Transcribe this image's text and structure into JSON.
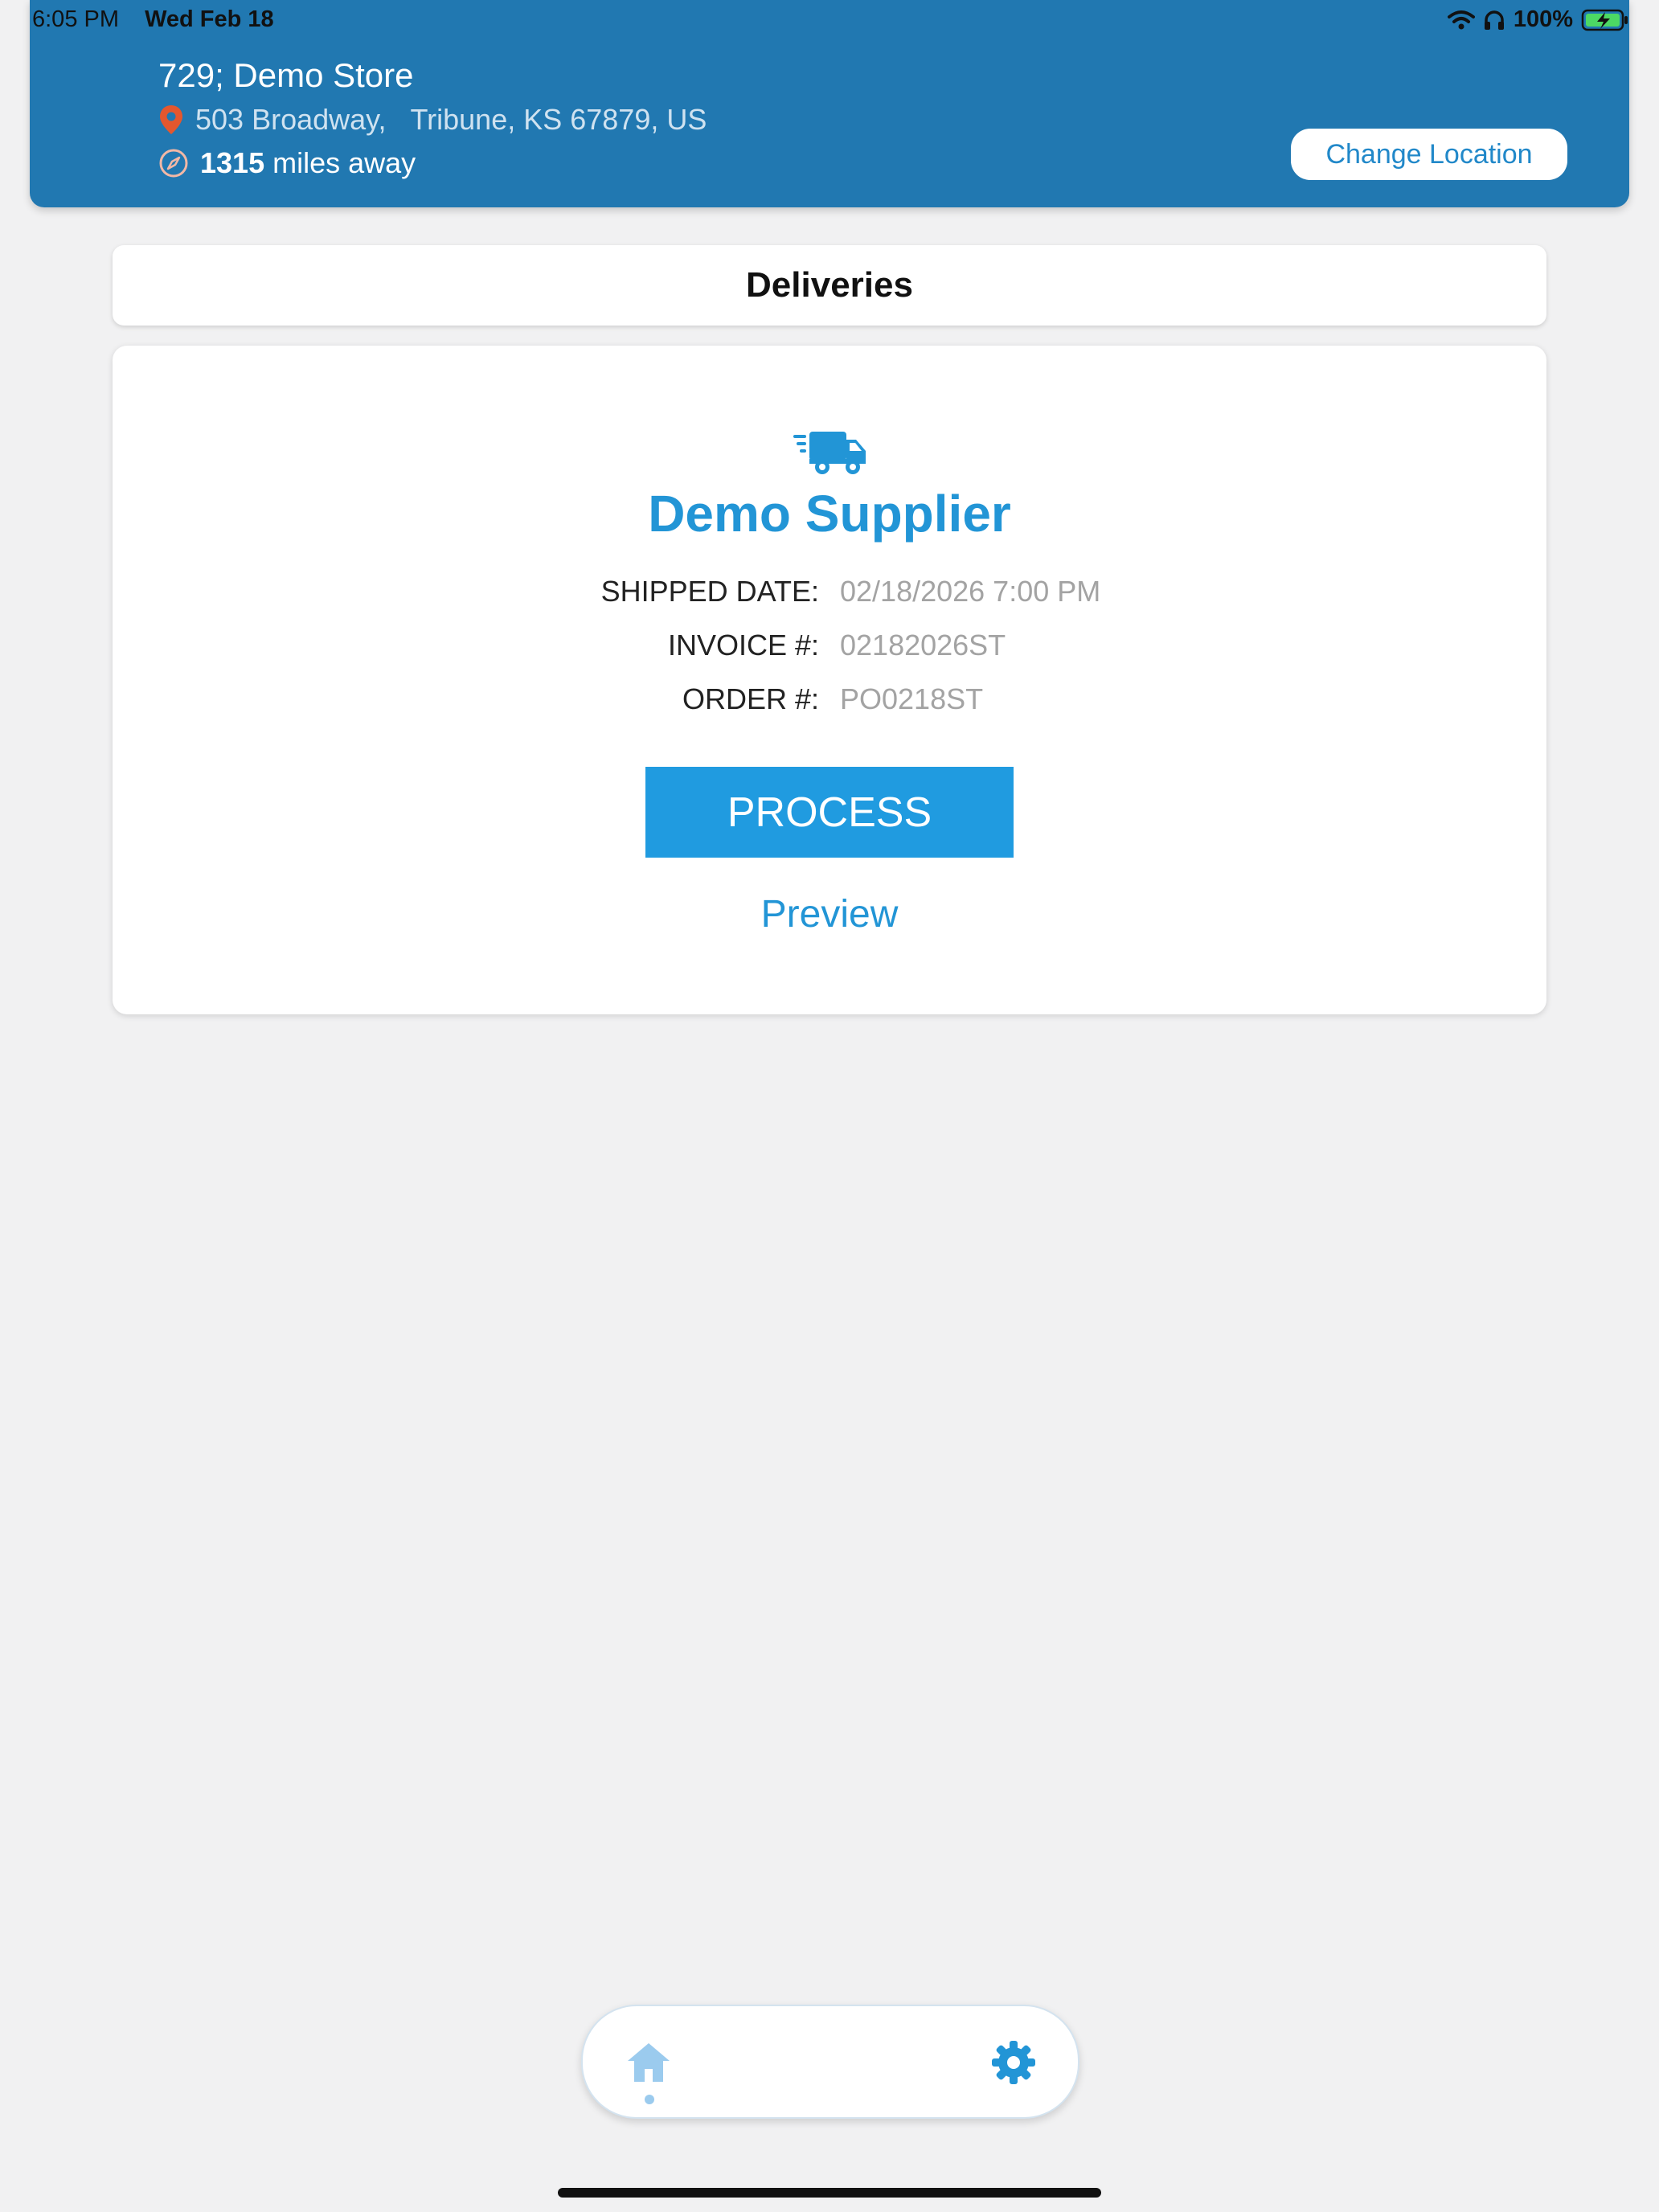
{
  "status_bar": {
    "time": "6:05 PM",
    "date": "Wed Feb 18",
    "battery": "100%"
  },
  "store": {
    "name": "729; Demo Store",
    "address_line": "503 Broadway,",
    "address_city": "Tribune, KS 67879, US",
    "distance_value": "1315",
    "distance_unit": "miles away",
    "change_location_label": "Change Location"
  },
  "page": {
    "title": "Deliveries"
  },
  "delivery": {
    "supplier": "Demo Supplier",
    "fields": [
      {
        "label": "SHIPPED DATE:",
        "value": "02/18/2026 7:00 PM"
      },
      {
        "label": "INVOICE #:",
        "value": "02182026ST"
      },
      {
        "label": "ORDER #:",
        "value": "PO0218ST"
      }
    ],
    "process_label": "PROCESS",
    "preview_label": "Preview"
  },
  "tabbar": {
    "items": [
      {
        "icon": "home-icon",
        "active": true
      },
      {
        "icon": "gear-icon",
        "active": false
      }
    ]
  },
  "colors": {
    "header": "#2178b1",
    "accent": "#2295d6",
    "button": "#209be0",
    "pin": "#e4572e"
  }
}
